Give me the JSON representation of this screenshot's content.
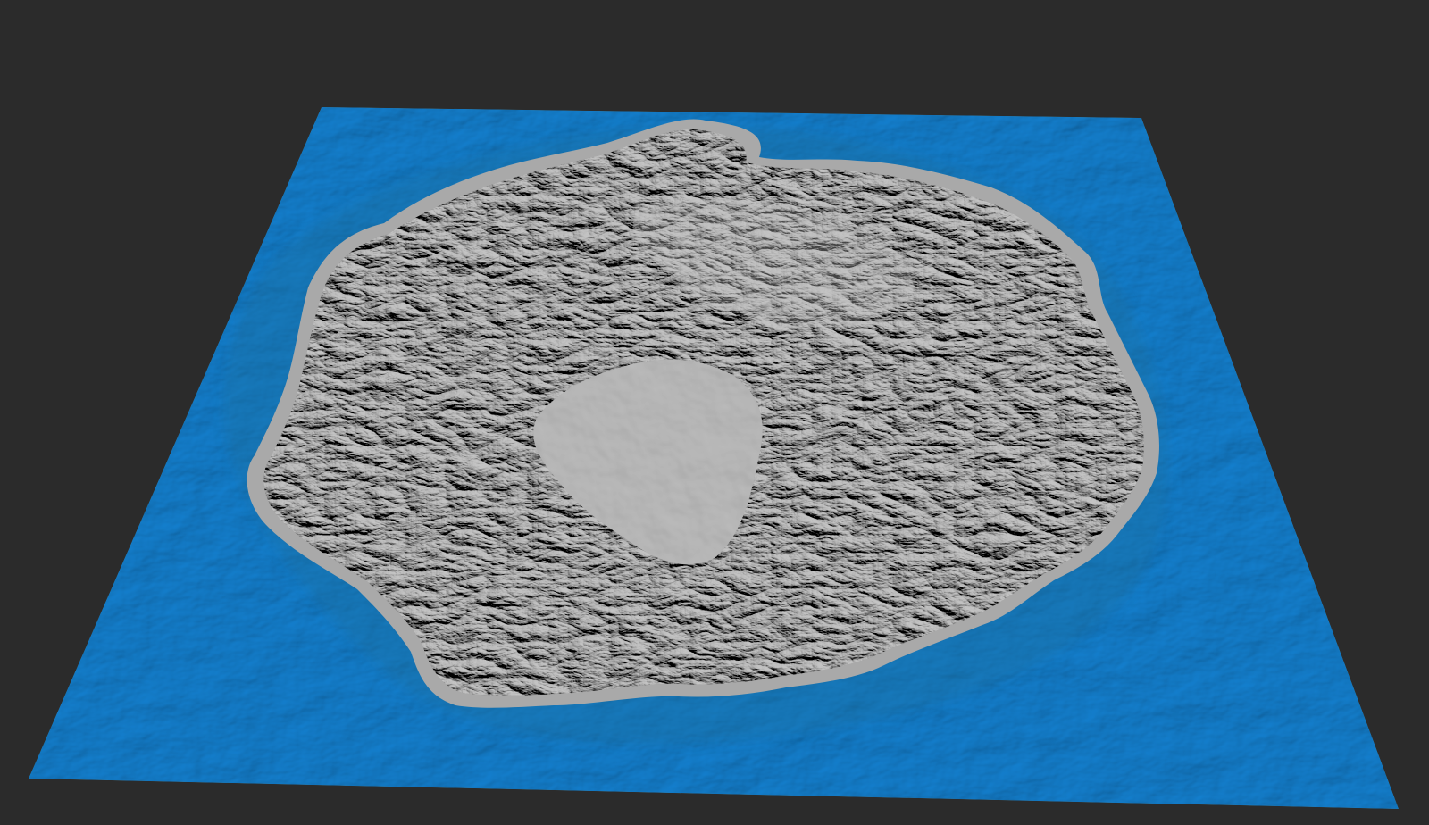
{
  "viewport": {
    "background_color": "#2b2b2b"
  },
  "terrain": {
    "water_color": "#2ea6e0",
    "water_highlight_color": "#6cc6ee",
    "water_shadow_color": "#1b6f9e",
    "shore_color": "#a9a9a9",
    "land_color": "#8e8e8e",
    "land_shadow_color": "#3f3f3f",
    "land_highlight_color": "#c4c4c4",
    "crater_floor_color": "#9c9c9c"
  }
}
